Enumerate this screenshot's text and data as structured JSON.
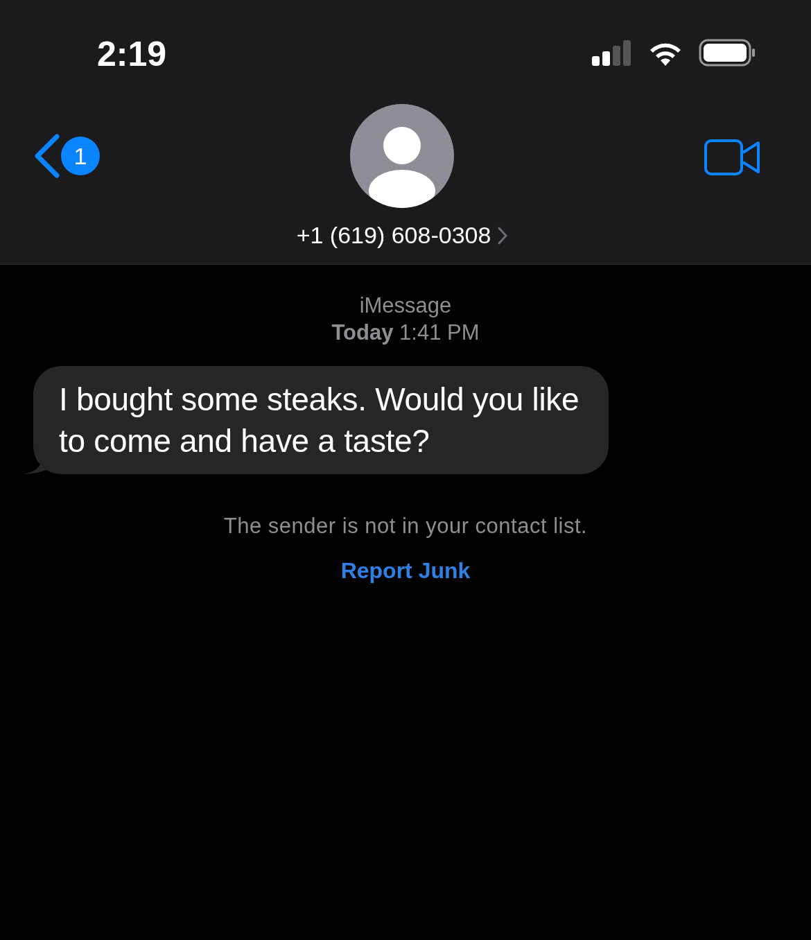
{
  "status_bar": {
    "time": "2:19"
  },
  "header": {
    "back_badge": "1",
    "contact": "+1 (619) 608-0308"
  },
  "conversation": {
    "service": "iMessage",
    "timestamp": "**Today** 1:41 PM",
    "messages": [
      {
        "kind": "received",
        "text": "I bought some steaks. Would you like to come and have a taste?"
      }
    ],
    "notice": "The sender is not in your contact list.",
    "report_link": "Report Junk"
  }
}
